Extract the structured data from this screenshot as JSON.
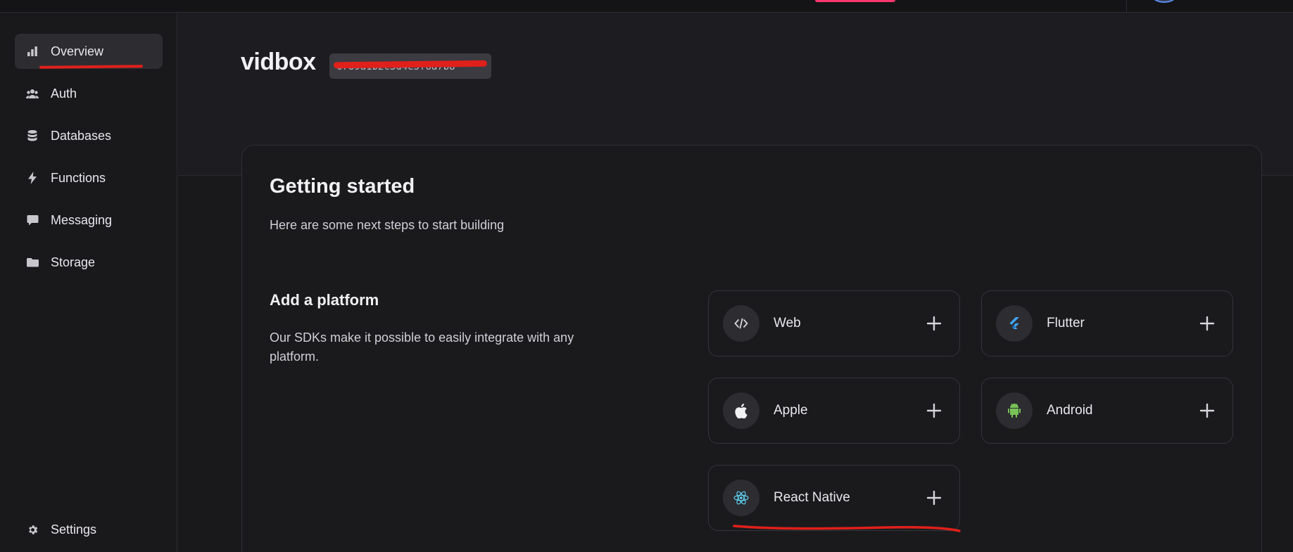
{
  "project": {
    "name": "vidbox",
    "id_masked": "6789a1b2c3d4e5f6a7b8"
  },
  "sidebar": {
    "items": [
      {
        "label": "Overview",
        "icon": "bar-chart-icon"
      },
      {
        "label": "Auth",
        "icon": "users-icon"
      },
      {
        "label": "Databases",
        "icon": "database-icon"
      },
      {
        "label": "Functions",
        "icon": "lightning-icon"
      },
      {
        "label": "Messaging",
        "icon": "chat-icon"
      },
      {
        "label": "Storage",
        "icon": "folder-icon"
      }
    ],
    "settings": {
      "label": "Settings",
      "icon": "gear-icon"
    }
  },
  "getting_started": {
    "title": "Getting started",
    "subtitle": "Here are some next steps to start building"
  },
  "add_platform": {
    "title": "Add a platform",
    "description": "Our SDKs make it possible to easily integrate with any platform.",
    "platforms": [
      {
        "label": "Web",
        "icon": "code-icon"
      },
      {
        "label": "Flutter",
        "icon": "flutter-icon"
      },
      {
        "label": "Apple",
        "icon": "apple-icon"
      },
      {
        "label": "Android",
        "icon": "android-icon"
      },
      {
        "label": "React Native",
        "icon": "react-icon"
      }
    ]
  },
  "colors": {
    "accent": "#fd366e",
    "annotation_red": "#e0201b",
    "flutter_blue": "#42a5f5",
    "android_green": "#78c257",
    "react_blue": "#61dafb"
  }
}
